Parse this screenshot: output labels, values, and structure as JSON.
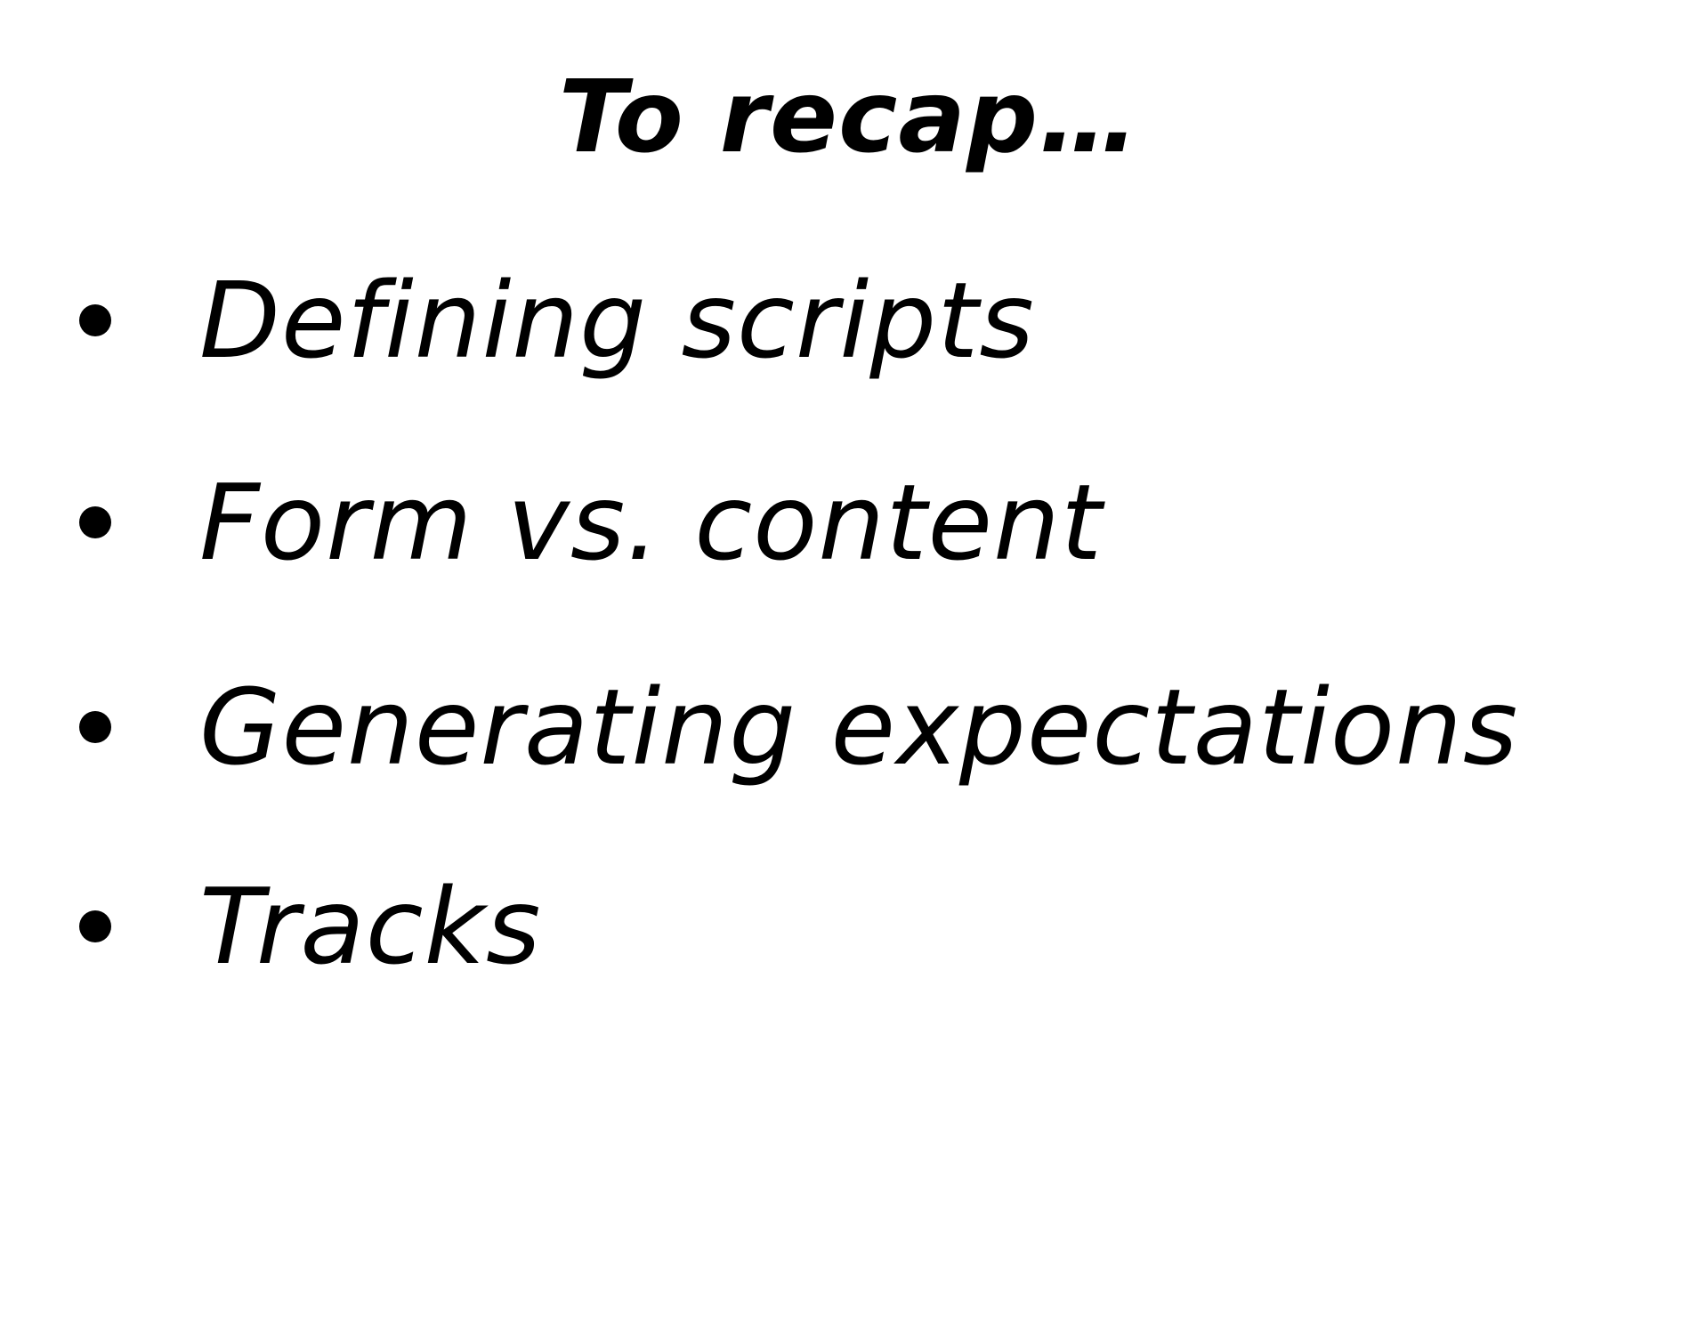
{
  "slide": {
    "title": "To recap…",
    "bullets": [
      {
        "label": "Defining scripts"
      },
      {
        "label": "Form vs. content"
      },
      {
        "label": "Generating expectations"
      },
      {
        "label": "Tracks"
      }
    ]
  }
}
